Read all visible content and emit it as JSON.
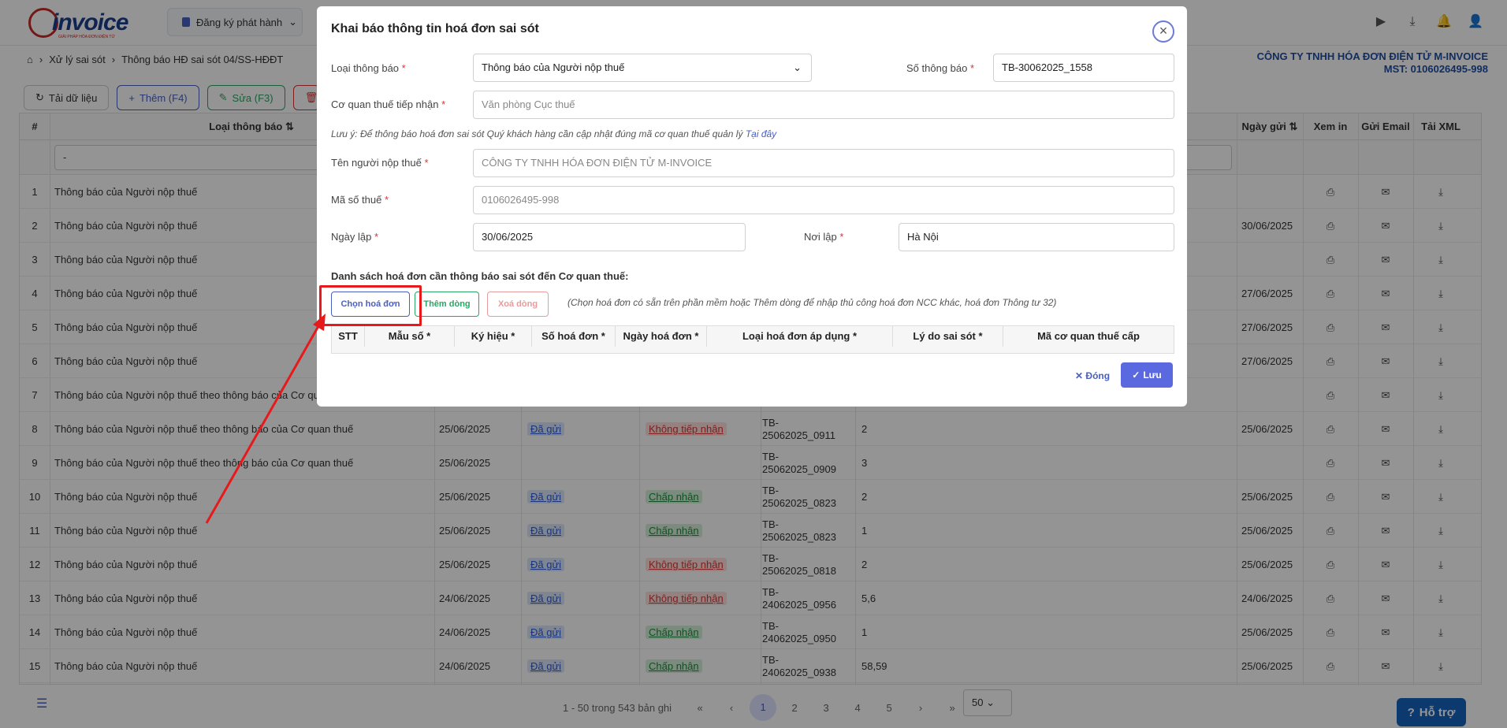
{
  "app": {
    "logo_text": "invoice",
    "logo_sub": "GIẢI PHÁP HÓA ĐƠN ĐIỆN TỬ",
    "register_label": "Đăng ký phát hành"
  },
  "breadcrumb": {
    "home_icon": "home-icon",
    "item1": "Xử lý sai sót",
    "item2": "Thông báo HĐ sai sót 04/SS-HĐĐT"
  },
  "company": {
    "name": "CÔNG TY TNHH HÓA ĐƠN ĐIỆN TỬ M-INVOICE",
    "tax": "MST: 0106026495-998"
  },
  "toolbar": {
    "reload": "Tải dữ liệu",
    "add": "Thêm (F4)",
    "edit": "Sửa (F3)"
  },
  "table": {
    "headers": {
      "num": "#",
      "type": "Loại thông báo",
      "sent_date": "Ngày gửi",
      "view": "Xem in",
      "email": "Gửi Email",
      "xml": "Tải XML"
    },
    "filter_value": "-",
    "rows": [
      {
        "n": "1",
        "type": "Thông báo của Người nộp thuế",
        "date": "",
        "status": "",
        "result": "",
        "code1": "",
        "code2": "",
        "note": "",
        "sent": ""
      },
      {
        "n": "2",
        "type": "Thông báo của Người nộp thuế",
        "date": "",
        "status": "",
        "result": "",
        "code1": "",
        "code2": "",
        "note": "",
        "sent": "30/06/2025"
      },
      {
        "n": "3",
        "type": "Thông báo của Người nộp thuế",
        "date": "",
        "status": "",
        "result": "",
        "code1": "",
        "code2": "",
        "note": "",
        "sent": ""
      },
      {
        "n": "4",
        "type": "Thông báo của Người nộp thuế",
        "date": "",
        "status": "",
        "result": "",
        "code1": "",
        "code2": "",
        "note": "",
        "sent": "27/06/2025"
      },
      {
        "n": "5",
        "type": "Thông báo của Người nộp thuế",
        "date": "",
        "status": "",
        "result": "",
        "code1": "",
        "code2": "",
        "note": "",
        "sent": "27/06/2025"
      },
      {
        "n": "6",
        "type": "Thông báo của Người nộp thuế",
        "date": "",
        "status": "",
        "result": "",
        "code1": "",
        "code2": "",
        "note": "",
        "sent": "27/06/2025"
      },
      {
        "n": "7",
        "type": "Thông báo của Người nộp thuế theo thông báo của Cơ quan",
        "date": "",
        "status": "",
        "result": "",
        "code1": "",
        "code2": "",
        "note": "",
        "sent": ""
      },
      {
        "n": "8",
        "type": "Thông báo của Người nộp thuế theo thông báo của Cơ quan thuế",
        "date": "25/06/2025",
        "status": "Đã gửi",
        "result": "Không tiếp nhận",
        "code1": "TB-",
        "code2": "25062025_0911",
        "note": "2",
        "sent": "25/06/2025"
      },
      {
        "n": "9",
        "type": "Thông báo của Người nộp thuế theo thông báo của Cơ quan thuế",
        "date": "25/06/2025",
        "status": "",
        "result": "",
        "code1": "TB-",
        "code2": "25062025_0909",
        "note": "3",
        "sent": ""
      },
      {
        "n": "10",
        "type": "Thông báo của Người nộp thuế",
        "date": "25/06/2025",
        "status": "Đã gửi",
        "result": "Chấp nhận",
        "code1": "TB-",
        "code2": "25062025_0823",
        "note": "2",
        "sent": "25/06/2025"
      },
      {
        "n": "11",
        "type": "Thông báo của Người nộp thuế",
        "date": "25/06/2025",
        "status": "Đã gửi",
        "result": "Chấp nhận",
        "code1": "TB-",
        "code2": "25062025_0823",
        "note": "1",
        "sent": "25/06/2025"
      },
      {
        "n": "12",
        "type": "Thông báo của Người nộp thuế",
        "date": "25/06/2025",
        "status": "Đã gửi",
        "result": "Không tiếp nhận",
        "code1": "TB-",
        "code2": "25062025_0818",
        "note": "2",
        "sent": "25/06/2025"
      },
      {
        "n": "13",
        "type": "Thông báo của Người nộp thuế",
        "date": "24/06/2025",
        "status": "Đã gửi",
        "result": "Không tiếp nhận",
        "code1": "TB-",
        "code2": "24062025_0956",
        "note": "5,6",
        "sent": "24/06/2025"
      },
      {
        "n": "14",
        "type": "Thông báo của Người nộp thuế",
        "date": "24/06/2025",
        "status": "Đã gửi",
        "result": "Chấp nhận",
        "code1": "TB-",
        "code2": "24062025_0950",
        "note": "1",
        "sent": "25/06/2025"
      },
      {
        "n": "15",
        "type": "Thông báo của Người nộp thuế",
        "date": "24/06/2025",
        "status": "Đã gửi",
        "result": "Chấp nhận",
        "code1": "TB-",
        "code2": "24062025_0938",
        "note": "58,59",
        "sent": "25/06/2025"
      }
    ]
  },
  "pagination": {
    "info": "1 - 50 trong 543 bản ghi",
    "first": "«",
    "prev": "‹",
    "p1": "1",
    "p2": "2",
    "p3": "3",
    "p4": "4",
    "p5": "5",
    "next": "›",
    "last": "»",
    "size": "50"
  },
  "help": {
    "label": "Hỗ trợ"
  },
  "modal": {
    "title": "Khai báo thông tin hoá đơn sai sót",
    "type_label": "Loại thông báo",
    "type_value": "Thông báo của Người nộp thuế",
    "number_label": "Số thông báo",
    "number_value": "TB-30062025_1558",
    "agency_label": "Cơ quan thuế tiếp nhận",
    "agency_placeholder": "Văn phòng Cục thuế",
    "note": "Lưu ý: Để thông báo hoá đơn sai sót Quý khách hàng cần cập nhật đúng mã cơ quan thuế quản lý",
    "note_link": "Tại đây",
    "payer_label": "Tên người nộp thuế",
    "payer_value": "CÔNG TY TNHH HÓA ĐƠN ĐIỆN TỬ M-INVOICE",
    "tax_label": "Mã số thuế",
    "tax_value": "0106026495-998",
    "date_label": "Ngày lập",
    "date_value": "30/06/2025",
    "place_label": "Nơi lập",
    "place_value": "Hà Nội",
    "section": "Danh sách hoá đơn cần thông báo sai sót đến Cơ quan thuế:",
    "choose_btn": "Chọn hoá đơn",
    "add_row_btn": "Thêm dòng",
    "del_row_btn": "Xoá dòng",
    "hint": "(Chọn hoá đơn có sẵn trên phần mềm hoặc Thêm dòng để nhập thủ công hoá đơn NCC khác, hoá đơn Thông tư 32)",
    "cols": [
      "STT",
      "Mẫu số *",
      "Ký hiệu *",
      "Số hoá đơn *",
      "Ngày hoá đơn *",
      "Loại hoá đơn áp dụng *",
      "Lý do sai sót *",
      "Mã cơ quan thuế cấp"
    ],
    "close_label": "Đóng",
    "save_label": "Lưu"
  },
  "colors": {
    "accent": "#5b69e0",
    "highlight": "#e8191b"
  }
}
